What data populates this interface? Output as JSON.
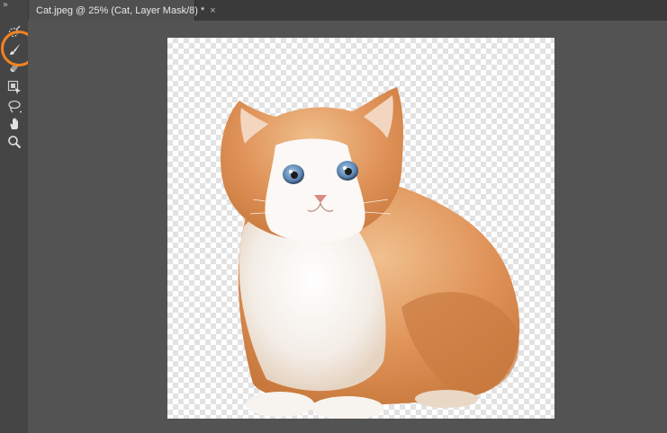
{
  "document_tab": {
    "title": "Cat.jpeg @ 25% (Cat, Layer Mask/8) *",
    "close_glyph": "×"
  },
  "toolbar": {
    "collapse_glyph": "»",
    "tools": [
      "quick-selection-icon",
      "brush-icon",
      "eraser-icon",
      "object-selection-icon",
      "lasso-icon",
      "hand-icon",
      "zoom-icon"
    ],
    "active_tool": "brush-icon"
  },
  "colors": {
    "highlight": "#f58220",
    "toolbar_bg": "#454545",
    "canvas_bg": "#535353"
  }
}
